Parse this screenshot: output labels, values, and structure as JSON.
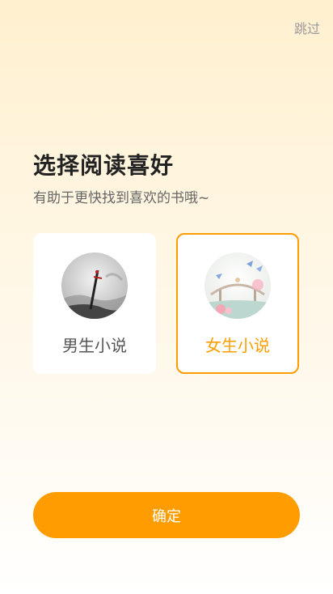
{
  "header": {
    "skip_label": "跳过"
  },
  "main": {
    "title": "选择阅读喜好",
    "subtitle": "有助于更快找到喜欢的书哦~",
    "options": [
      {
        "label": "男生小说",
        "image": "ink-wash-sword-illustration",
        "selected": false
      },
      {
        "label": "女生小说",
        "image": "floral-bird-bridge-illustration",
        "selected": true
      }
    ]
  },
  "footer": {
    "confirm_label": "确定"
  },
  "colors": {
    "accent": "#ff9d00",
    "title": "#222222",
    "subtitle": "#666666",
    "unselected_label": "#555555"
  }
}
